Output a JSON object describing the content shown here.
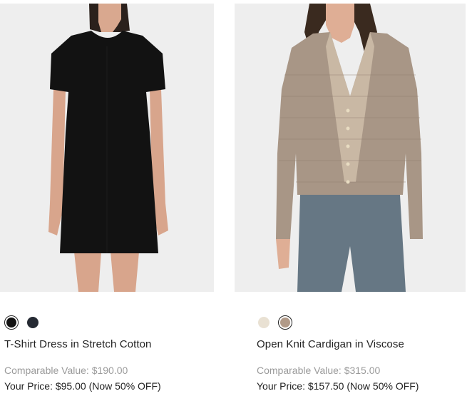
{
  "products": [
    {
      "name": "T-Shirt Dress in Stretch Cotton",
      "comparable": "Comparable Value: $190.00",
      "your_price": "Your Price: $95.00 (Now 50% OFF)",
      "swatches": [
        {
          "color": "#111111",
          "selected": true
        },
        {
          "color": "#252a33",
          "selected": false
        }
      ]
    },
    {
      "name": "Open Knit Cardigan in Viscose",
      "comparable": "Comparable Value: $315.00",
      "your_price": "Your Price: $157.50 (Now 50% OFF)",
      "swatches": [
        {
          "color": "#e9e1d3",
          "selected": false
        },
        {
          "color": "#b19a88",
          "selected": true
        }
      ]
    }
  ],
  "colors": {
    "image_bg": "#eeeeee",
    "muted_text": "#9a9a9a",
    "text": "#222222"
  }
}
